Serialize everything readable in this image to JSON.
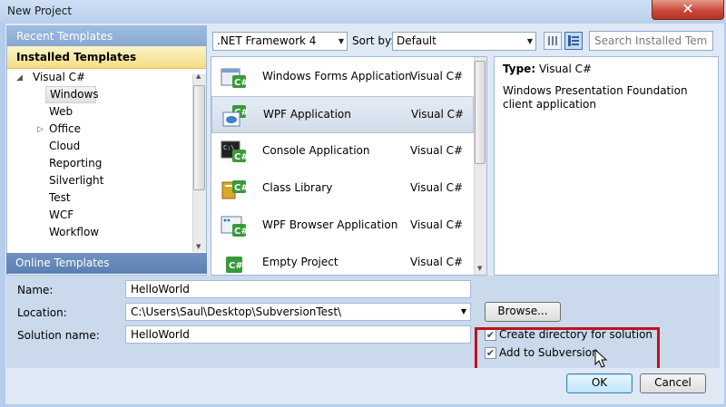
{
  "window": {
    "title": "New Project",
    "close_glyph": "✕"
  },
  "left_pane": {
    "recent_header": "Recent Templates",
    "installed_header": "Installed Templates",
    "online_header": "Online Templates",
    "tree": [
      {
        "label": "Visual C#",
        "expanded": true
      },
      {
        "label": "Windows",
        "selected": true
      },
      {
        "label": "Web"
      },
      {
        "label": "Office",
        "expandable": true
      },
      {
        "label": "Cloud"
      },
      {
        "label": "Reporting"
      },
      {
        "label": "Silverlight"
      },
      {
        "label": "Test"
      },
      {
        "label": "WCF"
      },
      {
        "label": "Workflow"
      }
    ]
  },
  "toolbar": {
    "framework": ".NET Framework 4",
    "sort_label": "Sort by:",
    "sort_value": "Default",
    "search_placeholder": "Search Installed Tem"
  },
  "templates": [
    {
      "name": "Windows Forms Application",
      "lang": "Visual C#",
      "icon": "winforms-icon"
    },
    {
      "name": "WPF Application",
      "lang": "Visual C#",
      "icon": "wpf-icon",
      "selected": true
    },
    {
      "name": "Console Application",
      "lang": "Visual C#",
      "icon": "console-icon"
    },
    {
      "name": "Class Library",
      "lang": "Visual C#",
      "icon": "class-library-icon"
    },
    {
      "name": "WPF Browser Application",
      "lang": "Visual C#",
      "icon": "wpf-browser-icon"
    },
    {
      "name": "Empty Project",
      "lang": "Visual C#",
      "icon": "empty-project-icon"
    }
  ],
  "details": {
    "type_label": "Type:",
    "type_value": "Visual C#",
    "description": "Windows Presentation Foundation client application"
  },
  "form": {
    "name_label": "Name:",
    "name_value": "HelloWorld",
    "location_label": "Location:",
    "location_value": "C:\\Users\\Saul\\Desktop\\SubversionTest\\",
    "solution_label": "Solution name:",
    "solution_value": "HelloWorld",
    "browse_label": "Browse...",
    "create_dir_label": "Create directory for solution",
    "create_dir_checked": true,
    "add_svn_label": "Add to Subversion",
    "add_svn_checked": true,
    "ok_label": "OK",
    "cancel_label": "Cancel"
  },
  "colors": {
    "highlight": "#c0121c",
    "selection": "#f6dd84",
    "accent": "#3e6fb0"
  }
}
